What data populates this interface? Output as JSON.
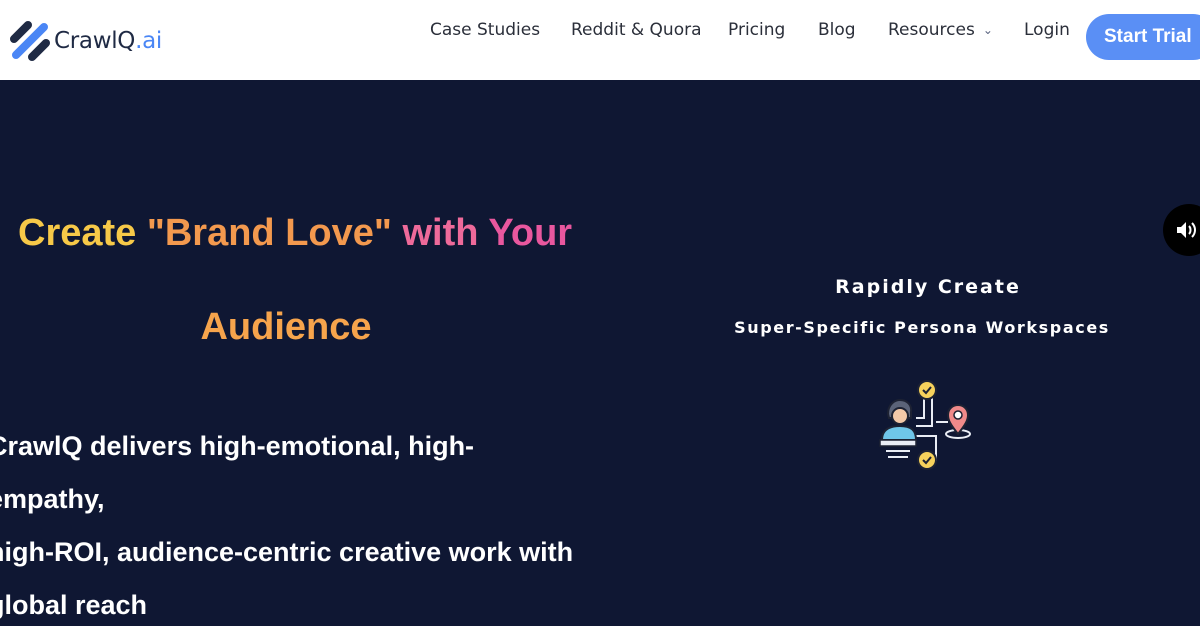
{
  "header": {
    "logo": {
      "name": "CrawlQ",
      "suffix": ".ai"
    },
    "nav": [
      {
        "label": "Case Studies"
      },
      {
        "label": "Reddit & Quora"
      },
      {
        "label": "Pricing"
      },
      {
        "label": "Blog"
      },
      {
        "label": "Resources",
        "has_dropdown": true
      },
      {
        "label": "Login"
      }
    ],
    "cta_label": "Start Trial"
  },
  "hero": {
    "headline": {
      "part1": "Create ",
      "part2": "\"Brand Love\"",
      "part3": " with ",
      "part4": "Your",
      "line2": "Audience"
    },
    "description_lines": [
      "CrawlQ delivers high-emotional, high-empathy,",
      "high-ROI, audience-centric creative work with",
      "global reach"
    ]
  },
  "feature": {
    "title": "Rapidly Create",
    "subtitle": "Super-Specific Persona Workspaces",
    "icon": "persona-workspace-icon"
  },
  "colors": {
    "background": "#0f1733",
    "accent": "#5a8ff5",
    "headline_yellow": "#f7c948",
    "headline_orange": "#f3994e",
    "headline_pink": "#e8579e"
  }
}
